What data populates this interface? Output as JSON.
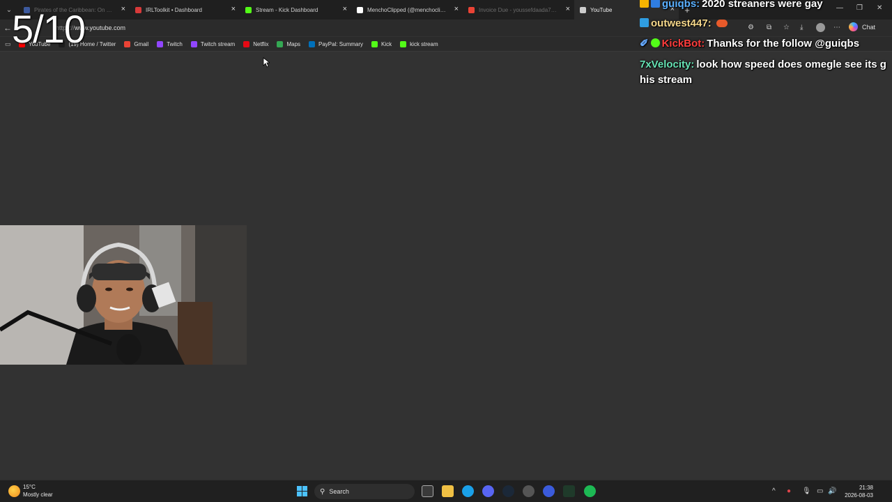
{
  "browser": {
    "tabs": [
      {
        "title": "Pirates of the Caribbean: On Strang",
        "favicon_color": "#3d5a9e",
        "dim": true
      },
      {
        "title": "IRLToolkit • Dashboard",
        "favicon_color": "#d83a3a",
        "dim": false
      },
      {
        "title": "Stream - Kick Dashboard",
        "favicon_color": "#53fc18",
        "dim": false
      },
      {
        "title": "MenchoClipped (@menchoclipped",
        "favicon_color": "#ffffff",
        "dim": false
      },
      {
        "title": "Invoice Due - youssefdaada78@g",
        "favicon_color": "#ea4335",
        "dim": true
      },
      {
        "title": "YouTube",
        "favicon_color": "#cccccc",
        "dim": false,
        "active": true
      }
    ],
    "address_scheme": "https://",
    "address_host": "www.youtube.com",
    "copilot_label": "Chat",
    "bookmarks": [
      {
        "label": "YouTube",
        "color": "#ff0000"
      },
      {
        "label": "(19) Home / Twitter",
        "color": "#1d1d1d"
      },
      {
        "label": "Gmail",
        "color": "#ea4335"
      },
      {
        "label": "Twitch",
        "color": "#9146ff"
      },
      {
        "label": "Twitch stream",
        "color": "#9146ff"
      },
      {
        "label": "Netflix",
        "color": "#e50914"
      },
      {
        "label": "Maps",
        "color": "#34a853"
      },
      {
        "label": "PayPal: Summary",
        "color": "#0070ba"
      },
      {
        "label": "Kick",
        "color": "#53fc18"
      },
      {
        "label": "kick stream",
        "color": "#53fc18"
      }
    ]
  },
  "overlay": {
    "counter": "5/10"
  },
  "chat": [
    {
      "user": "guiqbs:",
      "user_color": "#5ab0ff",
      "text": "2020 streaners were gay"
    },
    {
      "user": "outwest447:",
      "user_color": "#f5d78a",
      "text": ""
    },
    {
      "user": "KickBot:",
      "user_color": "#ff3c3c",
      "text": "Thanks for the follow @guiqbs"
    },
    {
      "user": "7xVelocity:",
      "user_color": "#66e3b4",
      "text": "look how speed does omegle see its g his stream"
    }
  ],
  "taskbar": {
    "weather_temp": "15°C",
    "weather_desc": "Mostly clear",
    "search_label": "Search",
    "time": "21:38",
    "date": "2026-08-03"
  },
  "colors": {
    "page_bg": "#323232",
    "taskbar_bg": "#202020",
    "kick_green": "#53fc18"
  }
}
